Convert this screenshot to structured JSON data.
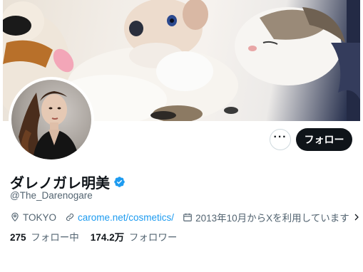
{
  "profile": {
    "display_name": "ダレノガレ明美",
    "handle": "@The_Darenogare",
    "location": "TOKYO",
    "website": "carome.net/cosmetics/",
    "joined": "2013年10月からXを利用しています"
  },
  "actions": {
    "more_label": "···",
    "follow_label": "フォロー"
  },
  "stats": {
    "following_count": "275",
    "following_label": "フォロー中",
    "followers_count": "174.2万",
    "followers_label": "フォロワー"
  },
  "icons": {
    "verified": "verified-badge-icon",
    "location": "location-pin-icon",
    "link": "link-icon",
    "calendar": "calendar-icon",
    "chevron": "chevron-right-icon"
  },
  "colors": {
    "accent": "#1d9bf0",
    "follow_button_bg": "#0f1419",
    "muted_text": "#536471"
  }
}
